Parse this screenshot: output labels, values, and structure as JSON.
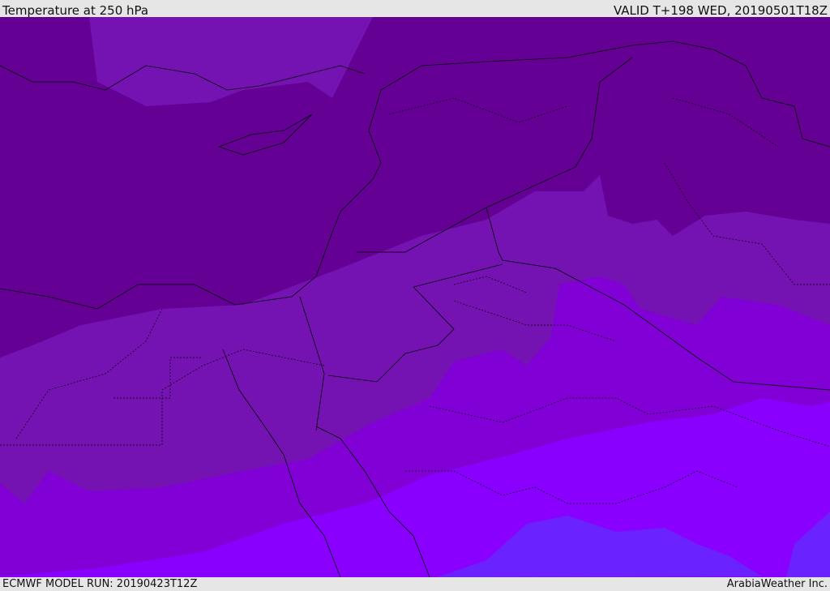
{
  "header": {
    "title": "Temperature at 250 hPa",
    "valid": "VALID T+198 WED, 20190501T18Z"
  },
  "footer": {
    "model_run": "ECMWF MODEL RUN: 20190423T12Z",
    "credit": "ArabiaWeather Inc."
  },
  "map": {
    "fill_colors": [
      "#650095",
      "#7412b2",
      "#8000d6",
      "#8a00ff",
      "#6a22ff"
    ]
  }
}
